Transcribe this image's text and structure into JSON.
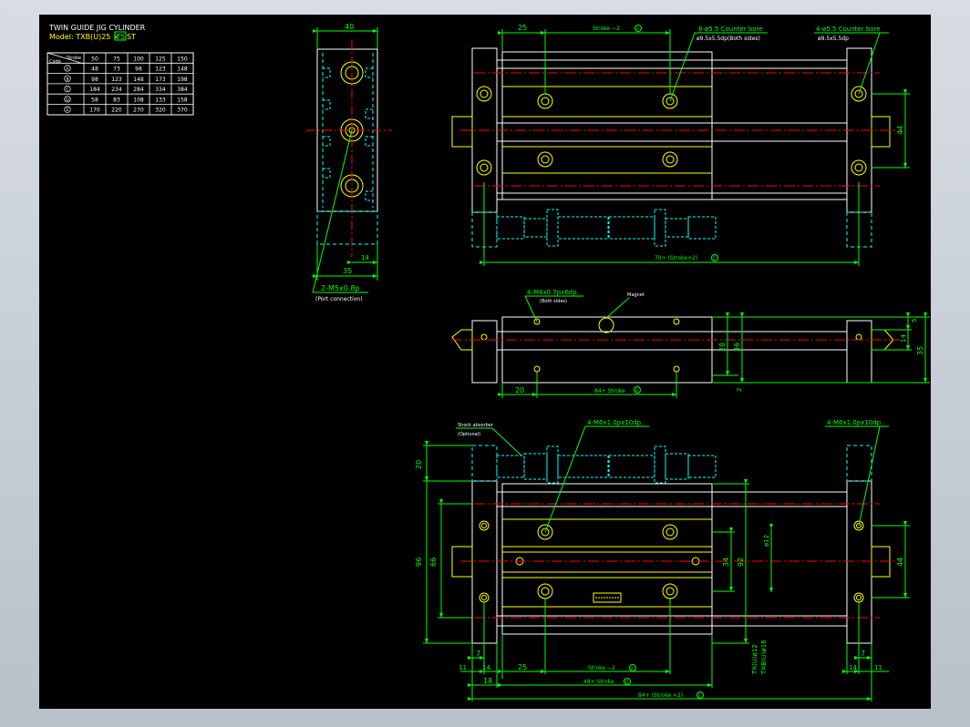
{
  "title_block": {
    "line1": "TWIN GUIDE JIG CYLINDER",
    "line2_prefix": "Model:  TXB(U)25 ×",
    "line2_box": "75",
    "line2_suffix": "ST"
  },
  "table": {
    "corner_top": "Stroke",
    "corner_bottom": "Code",
    "header": [
      "50",
      "75",
      "100",
      "125",
      "150"
    ],
    "rows": [
      {
        "code": "A",
        "values": [
          "48",
          "73",
          "98",
          "123",
          "148"
        ]
      },
      {
        "code": "B",
        "values": [
          "98",
          "123",
          "148",
          "173",
          "198"
        ]
      },
      {
        "code": "C",
        "values": [
          "184",
          "234",
          "284",
          "334",
          "384"
        ]
      },
      {
        "code": "D",
        "values": [
          "58",
          "83",
          "108",
          "133",
          "158"
        ]
      },
      {
        "code": "E",
        "values": [
          "170",
          "220",
          "270",
          "320",
          "370"
        ]
      }
    ]
  },
  "side_view": {
    "dim_top": "40",
    "dim_14": "14",
    "dim_35": "35",
    "port_label": "2-M5x0.8p",
    "port_sub": "(Port connection)"
  },
  "top_view": {
    "dim_25": "25",
    "dim_stroke": "Stroke −2",
    "dim_stroke_code": "A",
    "hole_label": "8-ø5.5 Counter bore",
    "hole_sub": "ø9.5x5.5dp(Both sides)",
    "hole_label_right": "4-ø5.5 Counter bore",
    "hole_sub_right": "ø9.5x5.5dp",
    "dim_44": "44",
    "dim_bottom": "70+ (Stroke×2)",
    "dim_bottom_code": "C"
  },
  "middle_view": {
    "tap_label": "4-M4x0.7px6dp.",
    "tap_sub": "(Both sides)",
    "magnet_label": "Magnet",
    "dim_20": "20",
    "dim_84": "84+ Stroke",
    "dim_84_code": "B",
    "dim_5": "5",
    "dim_14": "14",
    "dim_28": "28",
    "dim_36": "36",
    "dim_35": "35",
    "dim_2": "2"
  },
  "bottom_view": {
    "absorber_label": "Shock absorber",
    "absorber_sub": "(Optional)",
    "tap_label": "4-M6x1.0px10dp.",
    "tap_label_right": "4-M6x1.0px10dp.",
    "dim_20": "20",
    "dim_96": "96",
    "dim_66": "66",
    "dim_34": "34",
    "dim_92": "92",
    "dim_12": "ø12",
    "dim_44": "44",
    "dim_7": "7",
    "dim_7r": "7",
    "dim_11": "11",
    "dim_11r": "11",
    "dim_14": "14",
    "dim_14r": "14",
    "dim_25": "25",
    "dim_stroke": "Stroke −2",
    "dim_stroke_code": "A",
    "dim_18": "18",
    "dim_48": "48+ Stroke",
    "dim_48_code": "D",
    "dim_84": "84+ (Stroke ×2)",
    "dim_84_code": "E",
    "rod_a": "TX(U)ø12",
    "rod_b": "TXB(U)ø16"
  },
  "colors": {
    "background": "#000000",
    "part_outline": "#ffffff",
    "body_line": "#ffff00",
    "dimension": "#00ff00",
    "centerline": "#ff0000",
    "hidden": "#00ffff",
    "frame": "#c9cfd6"
  }
}
